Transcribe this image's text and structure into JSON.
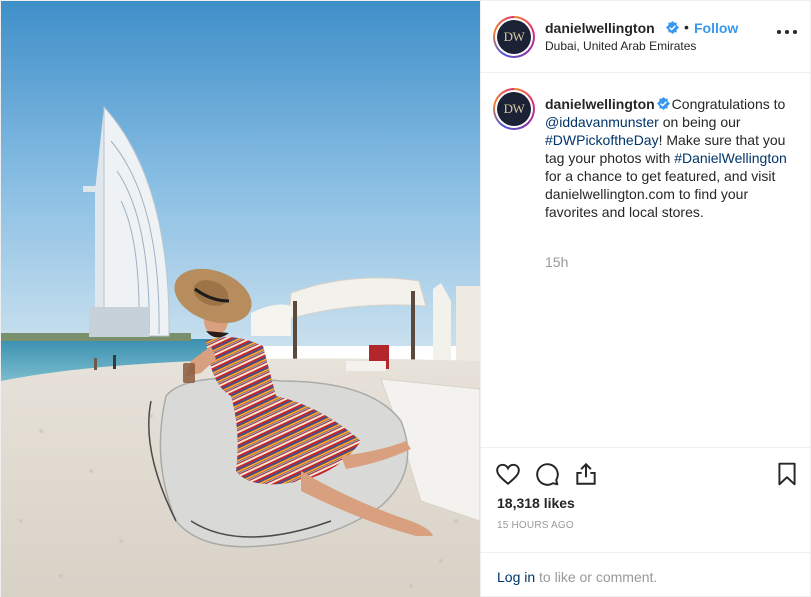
{
  "post": {
    "username": "danielwellington",
    "avatar_text": "DW",
    "follow_label": "Follow",
    "separator": "•",
    "location": "Dubai, United Arab Emirates"
  },
  "caption": {
    "username": "danielwellington",
    "text_1": "Congratulations to ",
    "mention": "@iddavanmunster",
    "text_2": " on being our ",
    "hashtag_1": "#DWPickoftheDay",
    "text_3": "! Make sure that you tag your photos with ",
    "hashtag_2": "#DanielWellington",
    "text_4": " for a chance to get featured, and visit danielwellington.com to find your favorites and local stores.",
    "time_ago": "15h"
  },
  "engagement": {
    "likes": "18,318 likes",
    "posted": "15 HOURS AGO",
    "login_link": "Log in",
    "login_suffix": " to like or comment."
  },
  "colors": {
    "link_blue": "#3897f0",
    "dark_link": "#003569",
    "verified_blue": "#3897f0",
    "muted": "#999999"
  },
  "icons": [
    "verified-badge-icon",
    "more-options-icon",
    "heart-icon",
    "comment-icon",
    "share-icon",
    "bookmark-icon"
  ]
}
